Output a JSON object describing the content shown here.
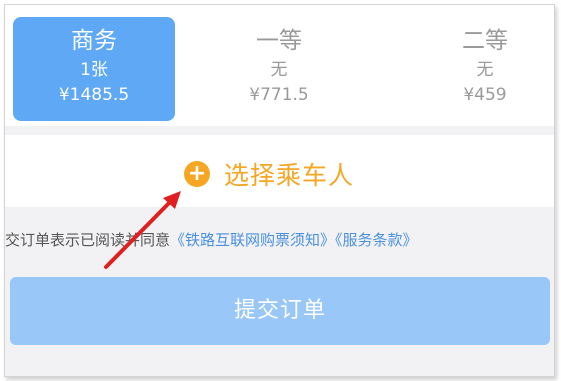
{
  "seats": [
    {
      "name": "商务",
      "count": "1张",
      "price": "¥1485.5",
      "selected": true
    },
    {
      "name": "一等",
      "count": "无",
      "price": "¥771.5",
      "selected": false
    },
    {
      "name": "二等",
      "count": "无",
      "price": "¥459",
      "selected": false
    }
  ],
  "passenger": {
    "add_label": "选择乘车人",
    "icon": "plus-circle-icon"
  },
  "agreement": {
    "prefix": "交订单表示已阅读并同意",
    "link1": "《铁路互联网购票须知》",
    "link2": "《服务条款》"
  },
  "submit": {
    "label": "提交订单"
  },
  "annotation": {
    "color": "#e02020"
  },
  "colors": {
    "accent": "#5fa8f5",
    "orange": "#f5a623",
    "link": "#4a90e2"
  }
}
